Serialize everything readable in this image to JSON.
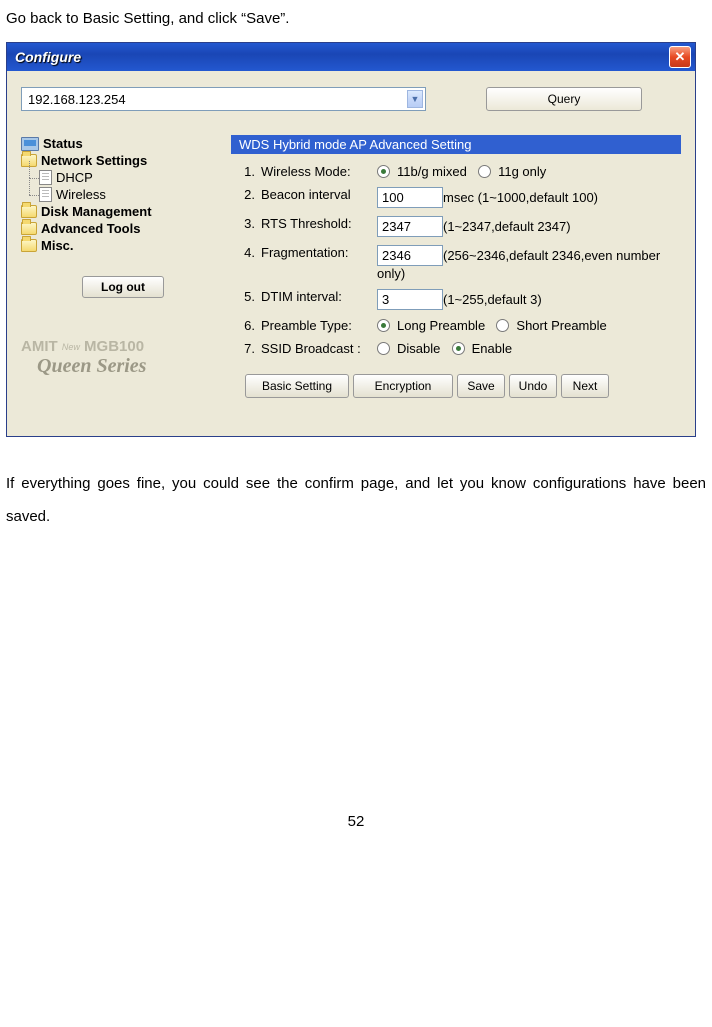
{
  "doc": {
    "intro_text": "Go back to Basic Setting, and click “Save”.",
    "outro_text": "If everything goes fine, you could see the confirm page, and let you know configurations have been saved.",
    "page_number": "52"
  },
  "window": {
    "title": "Configure",
    "address_value": "192.168.123.254",
    "query_label": "Query"
  },
  "sidebar": {
    "items": [
      {
        "label": "Status",
        "type": "monitor"
      },
      {
        "label": "Network Settings",
        "type": "folder"
      },
      {
        "label": "DHCP",
        "type": "doc",
        "sub": true,
        "cls": "first"
      },
      {
        "label": "Wireless",
        "type": "doc",
        "sub": true,
        "cls": "last"
      },
      {
        "label": "Disk Management",
        "type": "folder"
      },
      {
        "label": "Advanced Tools",
        "type": "folder"
      },
      {
        "label": "Misc.",
        "type": "folder"
      }
    ],
    "logout_label": "Log out",
    "brand_amit": "AMIT",
    "brand_new": "New",
    "brand_model": "MGB100",
    "brand_series": "Queen Series"
  },
  "panel": {
    "header": "WDS Hybrid mode AP Advanced Setting",
    "settings": [
      {
        "num": "1.",
        "label": "Wireless Mode:",
        "type": "radio",
        "options": [
          {
            "label": "11b/g mixed",
            "checked": true
          },
          {
            "label": "11g only",
            "checked": false
          }
        ]
      },
      {
        "num": "2.",
        "label": "Beacon interval",
        "type": "text",
        "value": "100",
        "hint": "msec (1~1000,default 100)"
      },
      {
        "num": "3.",
        "label": "RTS Threshold:",
        "type": "text",
        "value": "2347",
        "hint": "(1~2347,default 2347)"
      },
      {
        "num": "4.",
        "label": "Fragmentation:",
        "type": "text",
        "value": "2346",
        "hint": "(256~2346,default 2346,even number only)"
      },
      {
        "num": "5.",
        "label": "DTIM interval:",
        "type": "text",
        "value": "3",
        "hint": "(1~255,default 3)"
      },
      {
        "num": "6.",
        "label": "Preamble Type:",
        "type": "radio",
        "options": [
          {
            "label": "Long Preamble",
            "checked": true
          },
          {
            "label": "Short Preamble",
            "checked": false
          }
        ]
      },
      {
        "num": "7.",
        "label": "SSID Broadcast :",
        "type": "radio",
        "options": [
          {
            "label": "Disable",
            "checked": false
          },
          {
            "label": "Enable",
            "checked": true
          }
        ]
      }
    ],
    "buttons": {
      "basic": "Basic Setting",
      "encryption": "Encryption",
      "save": "Save",
      "undo": "Undo",
      "next": "Next"
    }
  }
}
